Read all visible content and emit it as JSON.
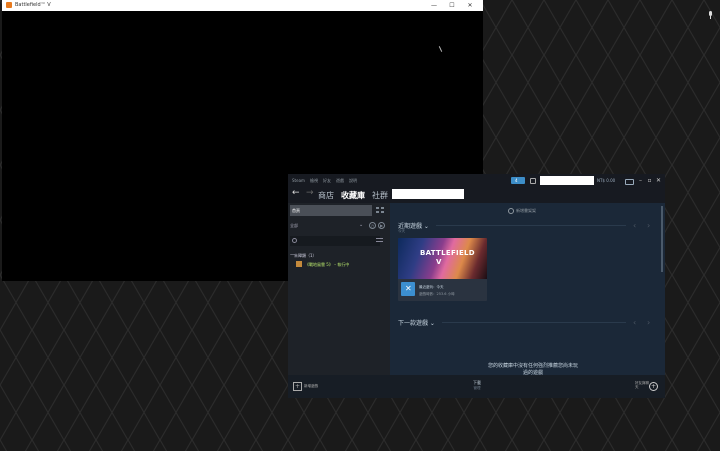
{
  "game_window": {
    "title": "Battlefield™ V",
    "btn_min": "—",
    "btn_max": "☐",
    "btn_close": "✕"
  },
  "steam": {
    "menu": [
      "Steam",
      "檢視",
      "好友",
      "遊戲",
      "說明"
    ],
    "notification_count": "4",
    "balance": "NT$ 0.00",
    "window_btns": [
      "–",
      "▫",
      "✕"
    ],
    "nav": {
      "back": "←",
      "forward": "→",
      "tabs": [
        "商店",
        "收藏庫",
        "社群"
      ]
    },
    "sidebar": {
      "home_label": "首頁",
      "filter_value": "全部",
      "filter_chevron": "⌄",
      "filter_clock": "◷",
      "filter_play": "▶",
      "category_arrow": "—",
      "category_label": "未歸類（1）",
      "game_item": "《戰地風雲 5》 – 執行中"
    },
    "main": {
      "add_shelf_label": "新增書架架",
      "recent_title": "近期遊戲 ⌄",
      "recent_subtitle": "今天",
      "prev_arrow": "‹",
      "next_arrow": "›",
      "card": {
        "art_title": "BATTLEFIELD",
        "art_roman": "V",
        "icon_glyph": "✕",
        "last_played": "最近遊玩：今天",
        "play_time": "遊戲時數：253.6 小時"
      },
      "next_title": "下一款遊戲 ⌄",
      "empty_line1": "您的收藏庫中沒有任何強烈推薦您尚未玩",
      "empty_line2": "過的遊戲"
    },
    "bottombar": {
      "add_game_icon": "+",
      "add_game_label": "新增遊戲",
      "downloads_label": "下載",
      "downloads_sub": "管理",
      "friends_label": "好友與聊天",
      "friends_icon": "+"
    }
  }
}
